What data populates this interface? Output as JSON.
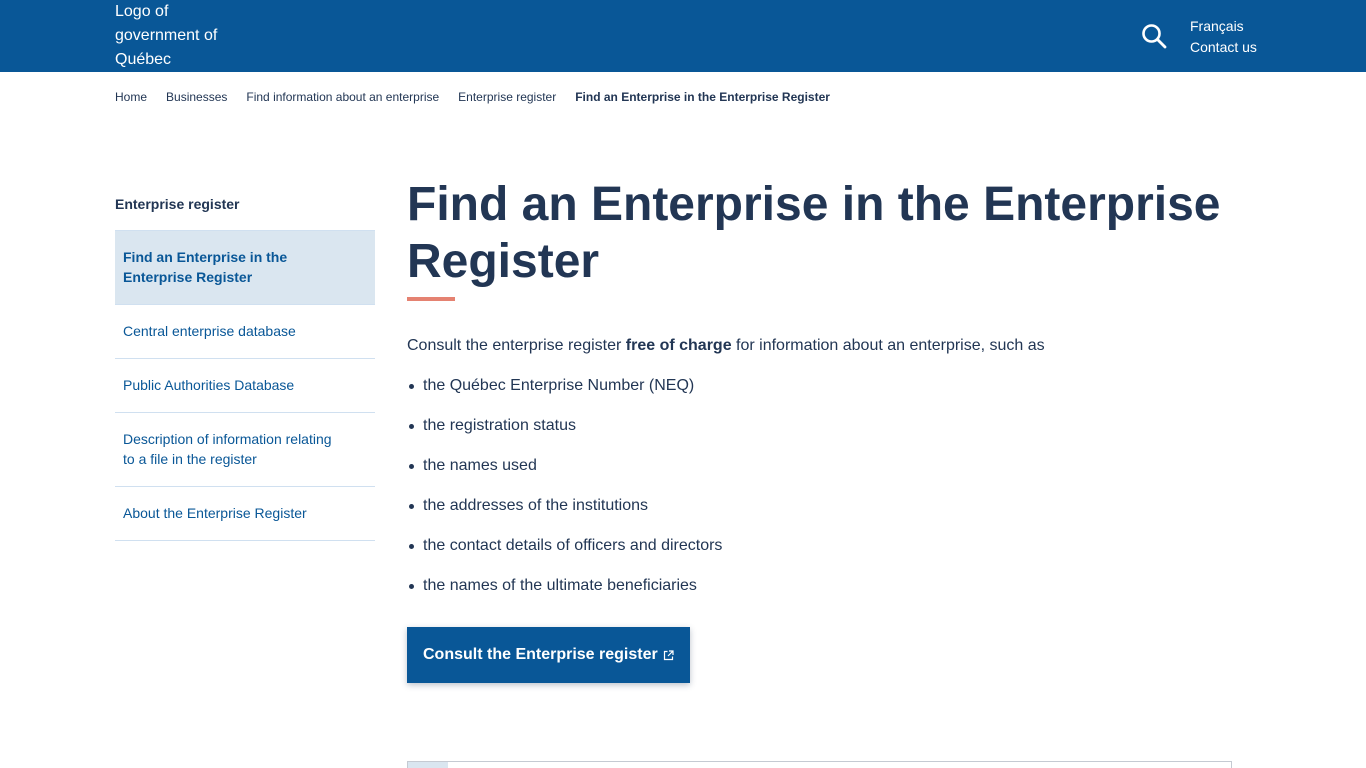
{
  "header": {
    "logo_alt": "Logo of government of Québec",
    "search_icon": "search-icon",
    "lang_label": "Français",
    "contact_label": "Contact us",
    "background_color": "#095797"
  },
  "breadcrumb": {
    "items": [
      "Home",
      "Businesses",
      "Find information about an enterprise",
      "Enterprise register"
    ],
    "current": "Find an Enterprise in the Enterprise Register"
  },
  "sidenav": {
    "title": "Enterprise register",
    "items": [
      "Find an Enterprise in the Enterprise Register",
      "Central enterprise database",
      "Public Authorities Database",
      "Description of information relating to a file in the register",
      "About the Enterprise Register"
    ],
    "active_index": 0
  },
  "main": {
    "title": "Find an Enterprise in the Enterprise Register",
    "intro_before": "Consult the enterprise register ",
    "intro_bold": "free of charge",
    "intro_after": " for information about an enterprise, such as",
    "bullets": [
      "the Québec Enterprise Number (NEQ)",
      "the registration status",
      "the names used",
      "the addresses of the institutions",
      "the contact details of officers and directors",
      "the names of the ultimate beneficiaries"
    ],
    "cta_label": "Consult the Enterprise register",
    "cta_icon": "external-link-icon",
    "accent_color": "#e58271"
  }
}
